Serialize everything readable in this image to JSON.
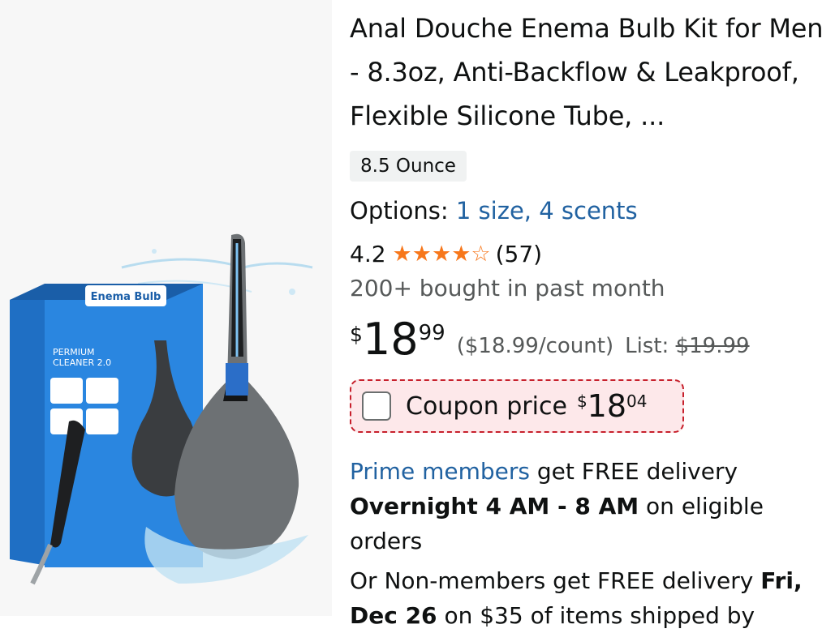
{
  "product": {
    "image_alt": "Enema bulb kit product image",
    "box_brand": "Enema Bulb",
    "box_line1": "PERMIUM",
    "box_line2": "CLEANER 2.0",
    "title": "Anal Douche Enema Bulb Kit for Men - 8.3oz, Anti-Backflow & Leakproof, Flexible Silicone Tube, ...",
    "size_chip": "8.5 Ounce",
    "options_label": "Options:",
    "options_link": "1 size, 4 scents",
    "rating_value": "4.2",
    "rating_count": "(57)",
    "stars": [
      "full",
      "full",
      "full",
      "full",
      "empty"
    ],
    "bought": "200+ bought in past month",
    "price_symbol": "$",
    "price_whole": "18",
    "price_fraction": "99",
    "unit_price": "($18.99/count)",
    "list_label": "List:",
    "list_price": "$19.99",
    "coupon_label": "Coupon price",
    "coupon_symbol": "$",
    "coupon_whole": "18",
    "coupon_fraction": "04",
    "prime_link": "Prime members",
    "prime_text": " get FREE delivery",
    "overnight_bold": "Overnight 4 AM - 8 AM",
    "overnight_text": " on eligible orders",
    "nonmember_text": "Or Non-members get FREE delivery ",
    "nonmember_date": "Fri, Dec 26",
    "nonmember_tail": " on $35 of items shipped by"
  },
  "colors": {
    "link": "#2162a1",
    "star": "#f7771b",
    "coupon_border": "#c7202c",
    "coupon_bg": "#fde8ea"
  }
}
